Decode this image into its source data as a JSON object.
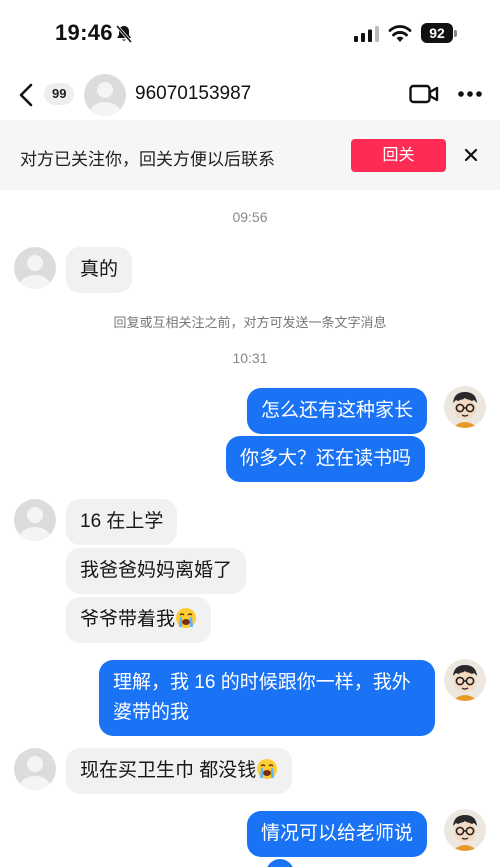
{
  "status_bar": {
    "time": "19:46",
    "battery": "92"
  },
  "nav": {
    "unread_count": "99",
    "contact_name": "96070153987"
  },
  "banner": {
    "text": "对方已关注你，回关方便以后联系",
    "button": "回关"
  },
  "chat": {
    "timestamp1": "09:56",
    "msg1": "真的",
    "system_note": "回复或互相关注之前，对方可发送一条文字消息",
    "timestamp2": "10:31",
    "msg2": "怎么还有这种家长",
    "msg3": "你多大？还在读书吗",
    "msg4": "16 在上学",
    "msg5": "我爸爸妈妈离婚了",
    "msg6": "爷爷带着我",
    "msg7_line1": "理解，我 16 的时候跟你一样，我外",
    "msg7_line2": "婆带的我",
    "msg8": "现在买卫生巾 都没钱",
    "msg9": "情况可以给老师说"
  },
  "colors": {
    "outgoing_bubble": "#1a73f5",
    "incoming_bubble": "#f1f1f2",
    "follow_button": "#fe2c55"
  },
  "icons": [
    "bell-slash-icon",
    "signal-icon",
    "wifi-icon",
    "back-chevron-icon",
    "video-call-icon",
    "more-icon",
    "close-icon",
    "crying-emoji-icon"
  ]
}
